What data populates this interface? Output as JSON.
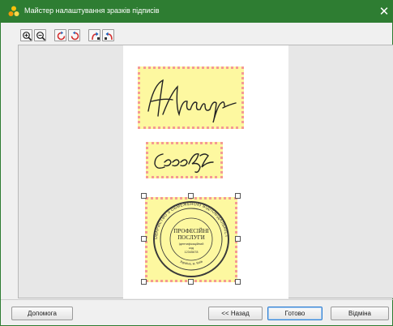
{
  "window": {
    "title": "Майстер налаштування зразків підписів",
    "close_glyph": "✕",
    "accent_color": "#2e7d32"
  },
  "toolbar": {
    "buttons": [
      {
        "icon": "zoom-in-icon"
      },
      {
        "icon": "zoom-out-icon"
      },
      {
        "icon": "rotate-left-icon"
      },
      {
        "icon": "rotate-right-icon"
      },
      {
        "icon": "flip-horizontal-icon"
      },
      {
        "icon": "flip-vertical-icon"
      }
    ]
  },
  "preview": {
    "items": [
      {
        "kind": "signature",
        "text": "Ар Вашуф"
      },
      {
        "kind": "signature",
        "text": "Соеф"
      },
      {
        "kind": "stamp",
        "text_ring": "ТОВАРИСТВО З ОБМЕЖЕНОЮ ВІДПОВІДАЛЬНІСТЮ",
        "text_center_1": "ПРОФЕСІЙНІ",
        "text_center_2": "ПОСЛУГИ",
        "text_small_1": "Ідентифікаційний",
        "text_small_2": "код",
        "text_small_3": "12345678",
        "text_bottom": "Україна, м. Київ"
      }
    ],
    "highlight_fill": "#fdf8a0",
    "highlight_border": "#f59a94"
  },
  "buttons": {
    "help": "Допомога",
    "back": "<< Назад",
    "done": "Готово",
    "cancel": "Відміна"
  }
}
